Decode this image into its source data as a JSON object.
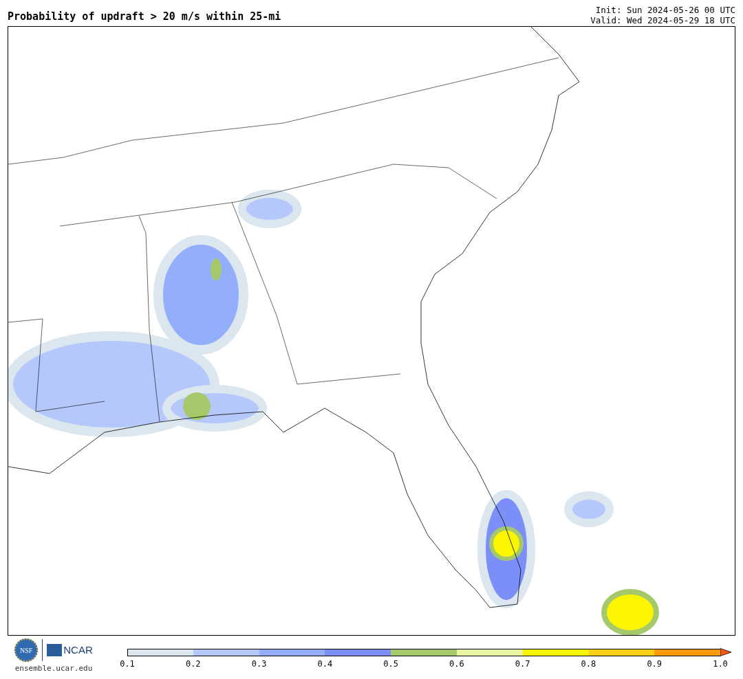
{
  "title": "Probability of updraft > 20 m/s within 25-mi",
  "init": "Init: Sun 2024-05-26 00 UTC",
  "valid": "Valid: Wed 2024-05-29 18 UTC",
  "logos": {
    "nsf": "NSF",
    "ncar": "NCAR",
    "url": "ensemble.ucar.edu"
  },
  "colorbar": {
    "segments": [
      {
        "color": "#dce6ef"
      },
      {
        "color": "#b5c8fb"
      },
      {
        "color": "#93aefb"
      },
      {
        "color": "#7c8ff9"
      },
      {
        "color": "#a5c96a"
      },
      {
        "color": "#eaf5a4"
      },
      {
        "color": "#fcf500"
      },
      {
        "color": "#fdd017"
      },
      {
        "color": "#fd9a0a"
      }
    ],
    "ticks": [
      "0.1",
      "0.2",
      "0.3",
      "0.4",
      "0.5",
      "0.6",
      "0.7",
      "0.8",
      "0.9",
      "1.0"
    ]
  }
}
